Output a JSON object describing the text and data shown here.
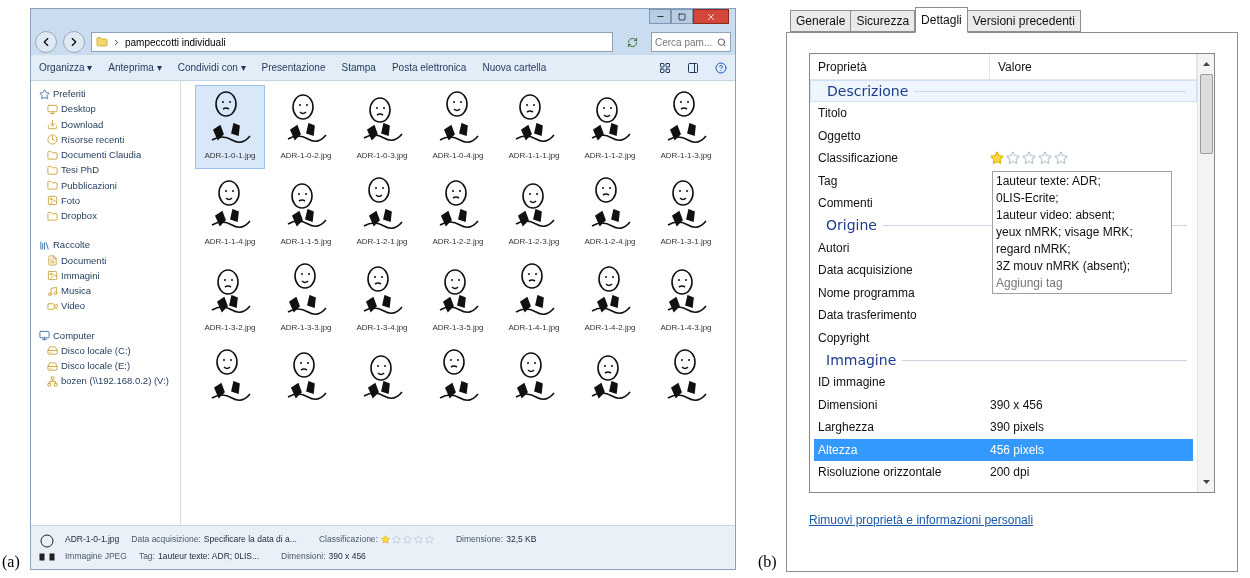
{
  "panel_a": {
    "caption": "(a)",
    "explorer": {
      "address": "pampeccotti individuali",
      "search": {
        "placeholder": "Cerca pam..."
      },
      "toolbar": [
        {
          "label": "Organizza ▾"
        },
        {
          "label": "Anteprima ▾"
        },
        {
          "label": "Condividi con ▾"
        },
        {
          "label": "Presentazione"
        },
        {
          "label": "Stampa"
        },
        {
          "label": "Posta elettronica"
        },
        {
          "label": "Nuova cartella"
        }
      ],
      "sidebar": [
        {
          "label": "Preferiti",
          "children": [
            {
              "label": "Desktop"
            },
            {
              "label": "Download"
            },
            {
              "label": "Risorse recenti"
            },
            {
              "label": "Documenti Claudia"
            },
            {
              "label": "Tesi PhD"
            },
            {
              "label": "Pubblicazioni"
            },
            {
              "label": "Foto"
            },
            {
              "label": "Dropbox"
            }
          ]
        },
        {
          "label": "Raccolte",
          "children": [
            {
              "label": "Documenti"
            },
            {
              "label": "Immagini"
            },
            {
              "label": "Musica"
            },
            {
              "label": "Video"
            }
          ]
        },
        {
          "label": "Computer",
          "children": [
            {
              "label": "Disco locale (C:)"
            },
            {
              "label": "Disco locale (E:)"
            },
            {
              "label": "bozen (\\\\192.168.0.2) (V:)"
            }
          ]
        }
      ],
      "files": [
        {
          "name": "ADR-1-0-1.jpg",
          "selected": true
        },
        {
          "name": "ADR-1-0-2.jpg",
          "selected": false
        },
        {
          "name": "ADR-1-0-3.jpg",
          "selected": false
        },
        {
          "name": "ADR-1-0-4.jpg",
          "selected": false
        },
        {
          "name": "ADR-1-1-1.jpg",
          "selected": false
        },
        {
          "name": "ADR-1-1-2.jpg",
          "selected": false
        },
        {
          "name": "ADR-1-1-3.jpg",
          "selected": false
        },
        {
          "name": "ADR-1-1-4.jpg",
          "selected": false
        },
        {
          "name": "ADR-1-1-5.jpg",
          "selected": false
        },
        {
          "name": "ADR-1-2-1.jpg",
          "selected": false
        },
        {
          "name": "ADR-1-2-2.jpg",
          "selected": false
        },
        {
          "name": "ADR-1-2-3.jpg",
          "selected": false
        },
        {
          "name": "ADR-1-2-4.jpg",
          "selected": false
        },
        {
          "name": "ADR-1-3-1.jpg",
          "selected": false
        },
        {
          "name": "ADR-1-3-2.jpg",
          "selected": false
        },
        {
          "name": "ADR-1-3-3.jpg",
          "selected": false
        },
        {
          "name": "ADR-1-3-4.jpg",
          "selected": false
        },
        {
          "name": "ADR-1-3-5.jpg",
          "selected": false
        },
        {
          "name": "ADR-1-4-1.jpg",
          "selected": false
        },
        {
          "name": "ADR-1-4-2.jpg",
          "selected": false
        },
        {
          "name": "ADR-1-4-3.jpg",
          "selected": false
        },
        {
          "selected": false
        },
        {
          "selected": false
        },
        {
          "selected": false
        },
        {
          "selected": false
        },
        {
          "selected": false
        },
        {
          "selected": false
        },
        {
          "selected": false
        }
      ],
      "status": {
        "filename": "ADR-1-0-1.jpg",
        "type": "Immagine JPEG",
        "line_1": [
          {
            "label": "Data acquisizione:",
            "value": "Specificare la data di a..."
          },
          {
            "label": "Classificazione:",
            "kind": "rating",
            "stars": 1
          },
          {
            "label": "Dimensione:",
            "value": "32,5 KB"
          }
        ],
        "line_2": [
          {
            "label": "Tag:",
            "value": "1auteur texte: ADR; 0LIS..."
          },
          {
            "label": "Dimensioni:",
            "value": "390 x 456"
          }
        ]
      }
    }
  },
  "panel_b": {
    "caption": "(b)",
    "tabs": [
      {
        "label": "Generale",
        "selected": false
      },
      {
        "label": "Sicurezza",
        "selected": false
      },
      {
        "label": "Dettagli",
        "selected": true
      },
      {
        "label": "Versioni precedenti",
        "selected": false
      }
    ],
    "columns": [
      "Proprietà",
      "Valore"
    ],
    "sections": [
      {
        "title": "Descrizione",
        "highlighted": true,
        "rows": [
          {
            "name": "Titolo",
            "selected": false
          },
          {
            "name": "Oggetto",
            "selected": false
          },
          {
            "name": "Classificazione",
            "kind": "rating",
            "stars": 1,
            "selected": false
          },
          {
            "name": "Tag",
            "kind": "editor",
            "lines": [
              "1auteur texte: ADR;",
              "0LIS-Ecrite;",
              "1auteur video: absent;",
              "yeux nMRK; visage MRK;",
              "regard nMRK;",
              "3Z mouv nMRK (absent);"
            ],
            "placeholder": "Aggiungi tag",
            "selected": false
          },
          {
            "name": "Commenti",
            "selected": false
          }
        ]
      },
      {
        "title": "Origine",
        "highlighted": false,
        "rows": [
          {
            "name": "Autori",
            "selected": false
          },
          {
            "name": "Data acquisizione",
            "selected": false
          },
          {
            "name": "Nome programma",
            "selected": false
          },
          {
            "name": "Data trasferimento",
            "selected": false
          },
          {
            "name": "Copyright",
            "selected": false
          }
        ]
      },
      {
        "title": "Immagine",
        "highlighted": false,
        "rows": [
          {
            "name": "ID immagine",
            "selected": false
          },
          {
            "name": "Dimensioni",
            "value": "390 x 456",
            "selected": false
          },
          {
            "name": "Larghezza",
            "value": "390 pixels",
            "selected": false
          },
          {
            "name": "Altezza",
            "value": "456 pixels",
            "selected": true
          },
          {
            "name": "Risoluzione orizzontale",
            "value": "200 dpi",
            "selected": false
          }
        ]
      }
    ],
    "link": "Rimuovi proprietà e informazioni personali"
  }
}
